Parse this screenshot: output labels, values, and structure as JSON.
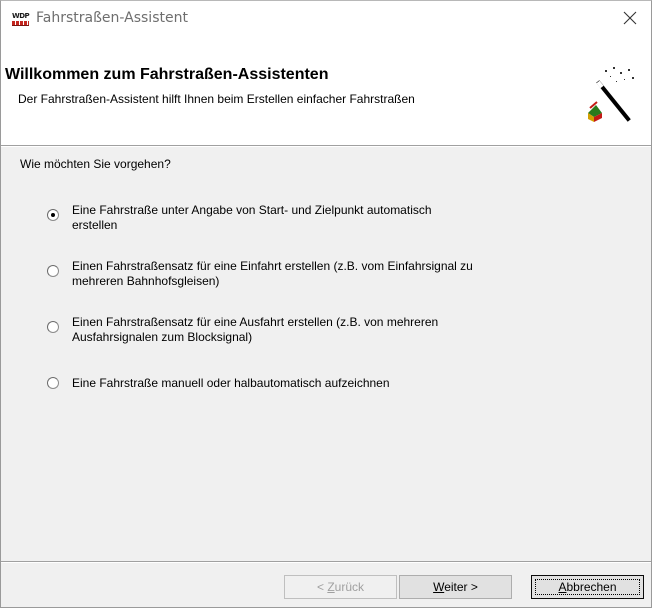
{
  "window": {
    "title": "Fahrstraßen-Assistent"
  },
  "header": {
    "title": "Willkommen zum Fahrstraßen-Assistenten",
    "description": "Der Fahrstraßen-Assistent hilft Ihnen beim Erstellen einfacher Fahrstraßen"
  },
  "content": {
    "question": "Wie möchten Sie vorgehen?",
    "options": [
      {
        "label": "Eine Fahrstraße unter Angabe von Start- und Zielpunkt automatisch\nerstellen",
        "selected": true
      },
      {
        "label": "Einen Fahrstraßensatz für eine Einfahrt erstellen (z.B. vom Einfahrsignal zu\nmehreren Bahnhofsgleisen)",
        "selected": false
      },
      {
        "label": "Einen Fahrstraßensatz für eine Ausfahrt erstellen (z.B. von mehreren\nAusfahrsignalen zum Blocksignal)",
        "selected": false
      },
      {
        "label": "Eine Fahrstraße manuell oder halbautomatisch aufzeichnen",
        "selected": false
      }
    ]
  },
  "buttons": {
    "back": {
      "prefix": "< ",
      "mnemonic": "Z",
      "rest": "urück",
      "enabled": false
    },
    "next": {
      "mnemonic": "W",
      "rest": "eiter >",
      "enabled": true
    },
    "cancel": {
      "mnemonic": "A",
      "rest": "bbrechen",
      "enabled": true,
      "default": true
    }
  },
  "icons": {
    "app": "wdp-app-icon",
    "close": "close-icon",
    "wizard": "magic-wand-icon"
  },
  "colors": {
    "dialog_background": "#f0f0f0",
    "header_background": "#ffffff",
    "title_text": "#6e6e6e",
    "disabled_text": "#a0a0a0"
  }
}
